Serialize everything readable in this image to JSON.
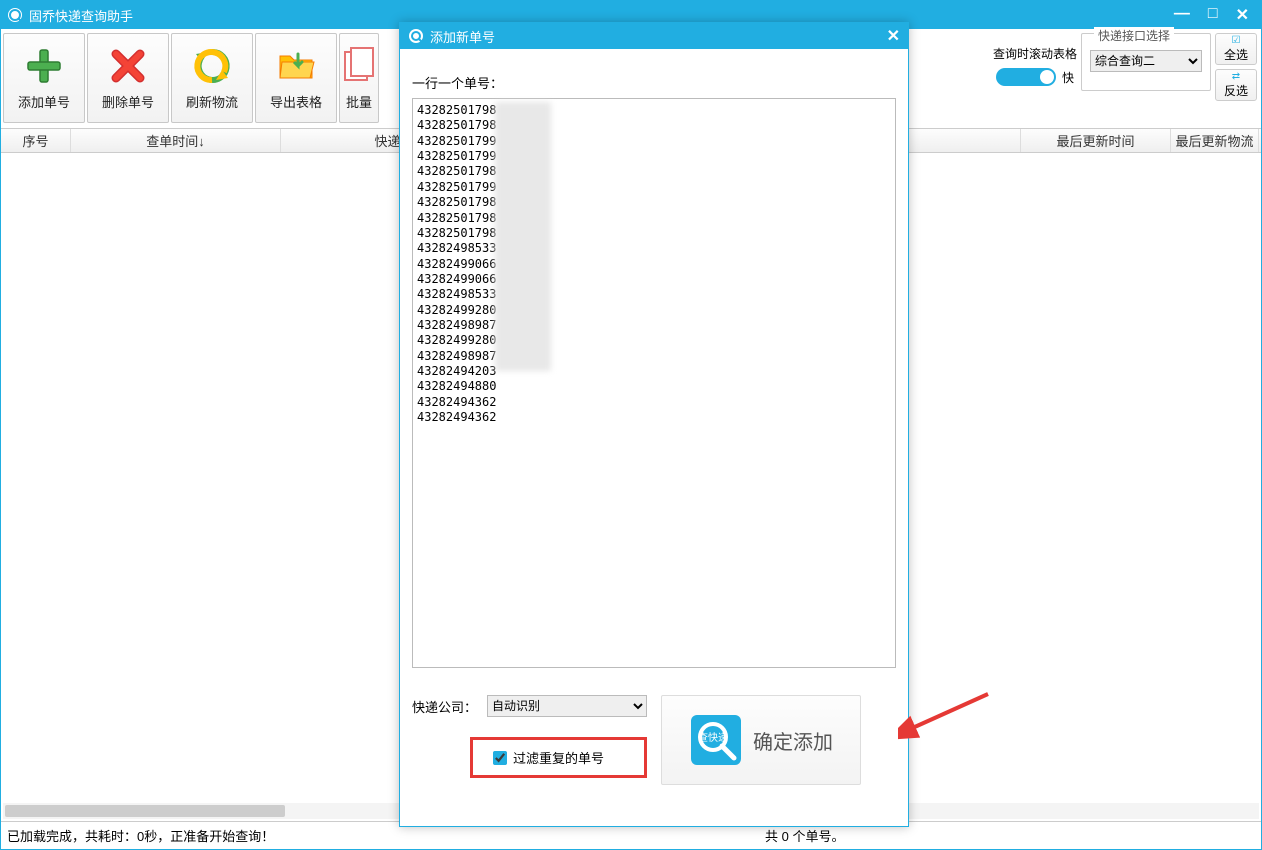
{
  "app": {
    "title": "固乔快递查询助手"
  },
  "toolbar": {
    "add": "添加单号",
    "delete": "删除单号",
    "refresh": "刷新物流",
    "export": "导出表格",
    "batch": "批量"
  },
  "right_controls": {
    "scroll_label": "查询时滚动表格",
    "scroll_suffix": "快",
    "api_group_title": "快递接口选择",
    "api_selected": "综合查询二",
    "select_all": "全选",
    "invert": "反选"
  },
  "table_headers": {
    "c1": "序号",
    "c2": "查单时间↓",
    "c3": "快递单号",
    "c5": "最后更新时间",
    "c6": "最后更新物流"
  },
  "status": {
    "left": "已加载完成，共耗时：0秒，正准备开始查询！",
    "mid": "共 0 个单号。"
  },
  "modal": {
    "title": "添加新单号",
    "input_label": "一行一个单号：",
    "numbers": "43282501798\n43282501798\n43282501799\n43282501799\n43282501798\n43282501799\n43282501798\n43282501798\n43282501798\n43282498533\n43282499066\n43282499066\n43282498533\n43282499280\n43282498987\n43282499280\n43282498987\n43282494203\n43282494880\n43282494362\n43282494362",
    "company_label": "快递公司：",
    "company_selected": "自动识别",
    "filter_label": "过滤重复的单号",
    "confirm": "确定添加"
  }
}
